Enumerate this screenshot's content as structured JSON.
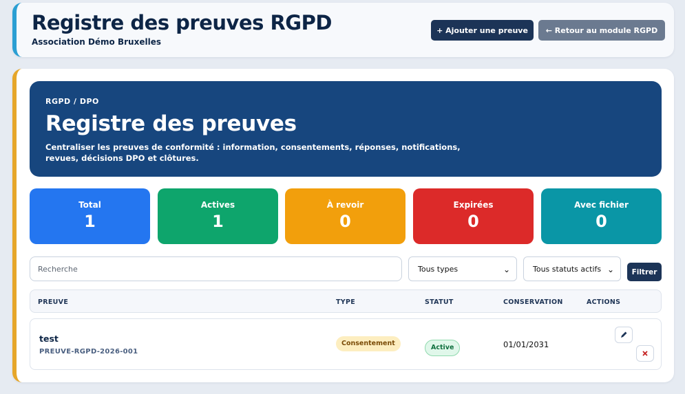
{
  "header": {
    "title": "Registre des preuves RGPD",
    "subtitle": "Association Démo Bruxelles",
    "add_button": "+ Ajouter une preuve",
    "back_button": "← Retour au module RGPD"
  },
  "hero": {
    "kicker": "RGPD / DPO",
    "title": "Registre des preuves",
    "description": "Centraliser les preuves de conformité : information, consentements, réponses, notifications, revues, décisions DPO et clôtures."
  },
  "stats": [
    {
      "label": "Total",
      "value": "1",
      "color": "#2476f0"
    },
    {
      "label": "Actives",
      "value": "1",
      "color": "#0ea56c"
    },
    {
      "label": "À revoir",
      "value": "0",
      "color": "#f29f0c"
    },
    {
      "label": "Expirées",
      "value": "0",
      "color": "#dc2a29"
    },
    {
      "label": "Avec fichier",
      "value": "0",
      "color": "#0a96a6"
    }
  ],
  "filters": {
    "search_placeholder": "Recherche",
    "type_selected": "Tous types",
    "status_selected": "Tous statuts actifs",
    "filter_button": "Filtrer"
  },
  "table": {
    "columns": [
      "PREUVE",
      "TYPE",
      "STATUT",
      "CONSERVATION",
      "ACTIONS"
    ],
    "rows": [
      {
        "title": "test",
        "reference": "PREUVE-RGPD-2026-001",
        "type": "Consentement",
        "status": "Active",
        "conservation": "01/01/2031",
        "edit_icon": "pencil-icon",
        "delete_icon": "close-icon"
      }
    ]
  }
}
